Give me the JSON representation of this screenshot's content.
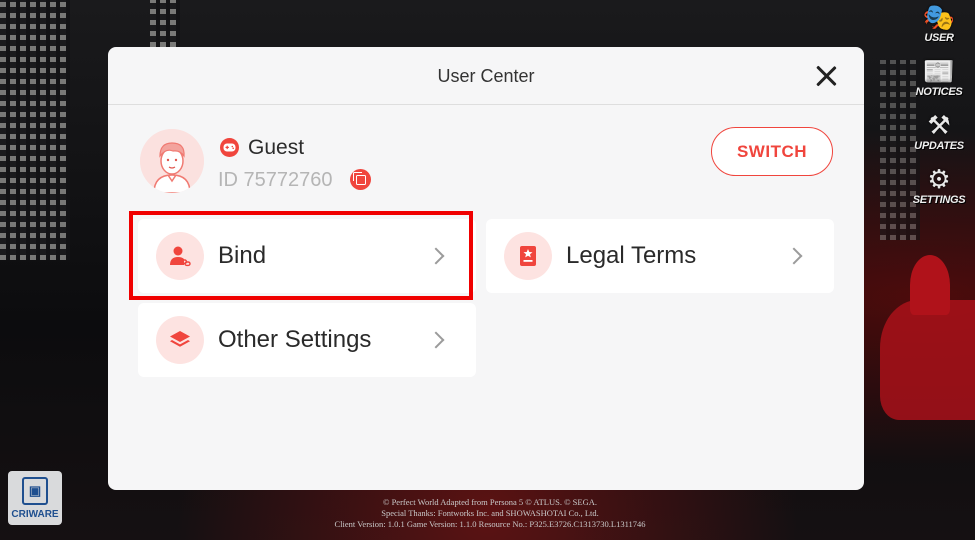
{
  "dialog": {
    "title": "User Center",
    "user": {
      "name": "Guest",
      "id_text": "ID 75772760"
    },
    "switch_label": "SWITCH",
    "menu": [
      {
        "key": "bind",
        "label": "Bind",
        "icon": "user-link-icon"
      },
      {
        "key": "legal",
        "label": "Legal Terms",
        "icon": "document-star-icon"
      },
      {
        "key": "other",
        "label": "Other Settings",
        "icon": "layers-icon"
      }
    ]
  },
  "side_menu": [
    {
      "label": "USER",
      "icon": "mask-icon"
    },
    {
      "label": "NOTICES",
      "icon": "news-icon"
    },
    {
      "label": "UPDATES",
      "icon": "tools-icon"
    },
    {
      "label": "SETTINGS",
      "icon": "gear-icon"
    }
  ],
  "criware": {
    "label": "CRIWARE"
  },
  "copyright": {
    "line1": "© Perfect World Adapted from Persona 5 © ATLUS. © SEGA.",
    "line2": "Special Thanks: Fontworks Inc. and SHOWASHOTAI Co., Ltd.",
    "line3": "Client Version: 1.0.1 Game Version: 1.1.0 Resource No.: P325.E3726.C1313730.L1311746"
  },
  "colors": {
    "accent": "#f0453d",
    "highlight": "#f00000",
    "dialog_bg": "#f6f6f7"
  }
}
